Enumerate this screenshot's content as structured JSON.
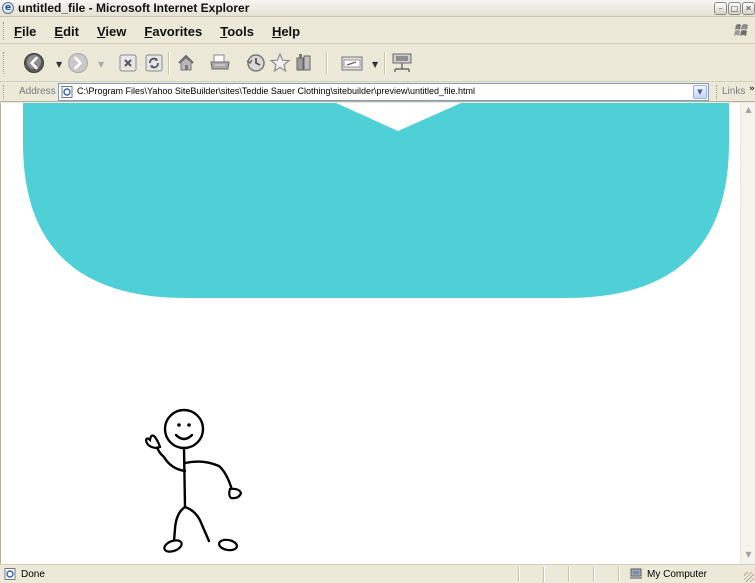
{
  "window": {
    "title": "untitled_file - Microsoft Internet Explorer",
    "icon": "ie-page-icon",
    "buttons": [
      "minimize",
      "restore",
      "close"
    ]
  },
  "menu": {
    "items": [
      {
        "label": "File"
      },
      {
        "label": "Edit"
      },
      {
        "label": "View"
      },
      {
        "label": "Favorites"
      },
      {
        "label": "Tools"
      },
      {
        "label": "Help"
      }
    ]
  },
  "toolbar": {
    "buttons": [
      "back-icon",
      "forward-icon",
      "stop-icon",
      "refresh-icon",
      "home-icon",
      "print-icon",
      "history-icon",
      "favorites-star-icon",
      "research-icon",
      "edit-icon",
      "network-icon"
    ]
  },
  "address": {
    "label": "Address",
    "url": "C:\\Program Files\\Yahoo SiteBuilder\\sites\\Teddie Sauer Clothing\\sitebuilder\\preview\\untitled_file.html",
    "links_label": "Links",
    "links_chevron": "»"
  },
  "colors": {
    "watermark": "#4fd0d6",
    "accent_blue": "#2a66c9",
    "chrome": "#ece9d8"
  },
  "status": {
    "text": "Done",
    "zone": "My Computer"
  }
}
